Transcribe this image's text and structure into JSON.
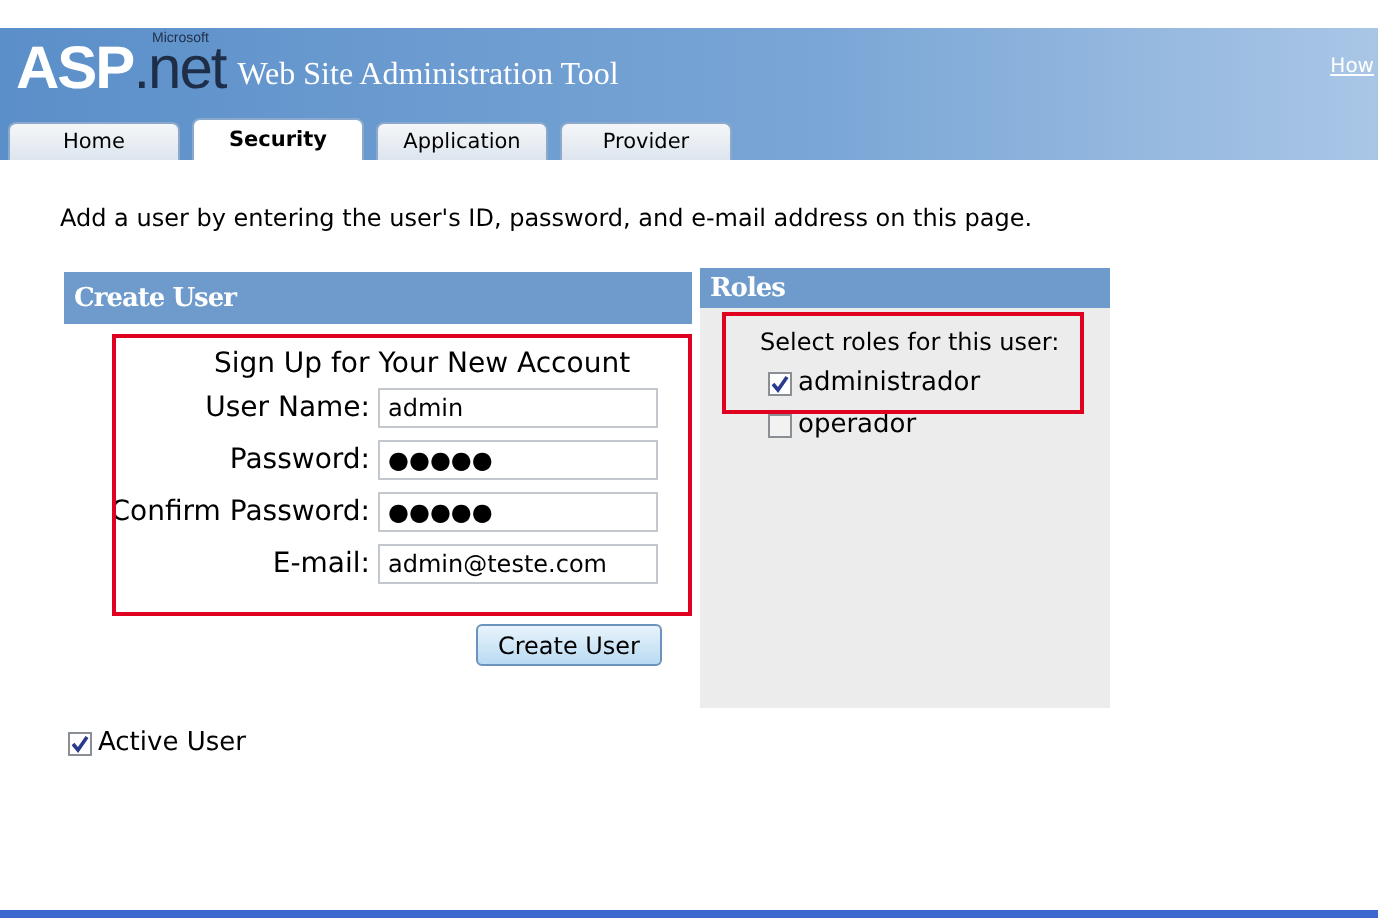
{
  "header": {
    "logo": {
      "brand": "ASP",
      "suffix": ".net",
      "maker": "Microsoft"
    },
    "title": "Web Site Administration Tool",
    "help_link": "How"
  },
  "tabs": [
    {
      "label": "Home",
      "selected": false
    },
    {
      "label": "Security",
      "selected": true
    },
    {
      "label": "Application",
      "selected": false
    },
    {
      "label": "Provider",
      "selected": false
    }
  ],
  "intro": "Add a user by entering the user's ID, password, and e-mail address on this page.",
  "create_user": {
    "heading": "Create User",
    "form_title": "Sign Up for Your New Account",
    "highlighted": true,
    "fields": [
      {
        "label": "User Name:",
        "value": "admin"
      },
      {
        "label": "Password:",
        "value": "●●●●●"
      },
      {
        "label": "Confirm Password:",
        "value": "●●●●●"
      },
      {
        "label": "E-mail:",
        "value": "admin@teste.com"
      }
    ],
    "button": "Create User"
  },
  "roles": {
    "heading": "Roles",
    "prompt": "Select roles for this user:",
    "highlighted": true,
    "items": [
      {
        "label": "administrador",
        "checked": true
      },
      {
        "label": "operador",
        "checked": false
      }
    ]
  },
  "active_user": {
    "label": "Active User",
    "checked": true
  }
}
